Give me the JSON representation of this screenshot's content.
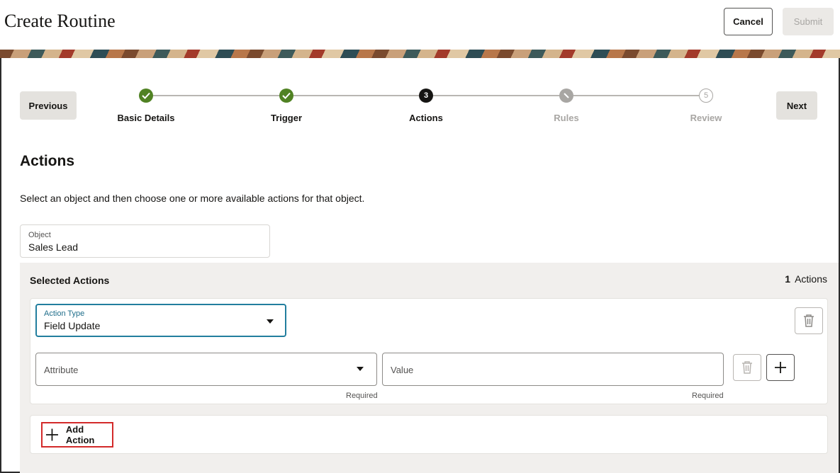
{
  "header": {
    "title": "Create Routine",
    "cancel_label": "Cancel",
    "submit_label": "Submit"
  },
  "train": {
    "previous_label": "Previous",
    "next_label": "Next",
    "steps": [
      {
        "label": "Basic Details",
        "state": "done",
        "marker": "✓"
      },
      {
        "label": "Trigger",
        "state": "done",
        "marker": "✓"
      },
      {
        "label": "Actions",
        "state": "current",
        "marker": "3"
      },
      {
        "label": "Rules",
        "state": "disabled",
        "marker": "⊘"
      },
      {
        "label": "Review",
        "state": "future",
        "marker": "5"
      }
    ]
  },
  "section": {
    "title": "Actions",
    "instructions": "Select an object and then choose one or more available actions for that object."
  },
  "object": {
    "label": "Object",
    "value": "Sales Lead"
  },
  "selected_actions": {
    "title": "Selected Actions",
    "count": "1",
    "count_label": "Actions",
    "action_type": {
      "label": "Action Type",
      "value": "Field Update"
    },
    "attribute": {
      "placeholder": "Attribute",
      "hint": "Required"
    },
    "value": {
      "placeholder": "Value",
      "hint": "Required"
    },
    "add_action_label": "Add Action"
  },
  "icons": {
    "delete": "trash-icon",
    "add": "plus-icon",
    "dropdown": "caret-down-icon",
    "check": "check-icon"
  },
  "colors": {
    "done": "#508223",
    "current": "#161513",
    "focus": "#227e9e",
    "highlight": "#d32a2a"
  }
}
